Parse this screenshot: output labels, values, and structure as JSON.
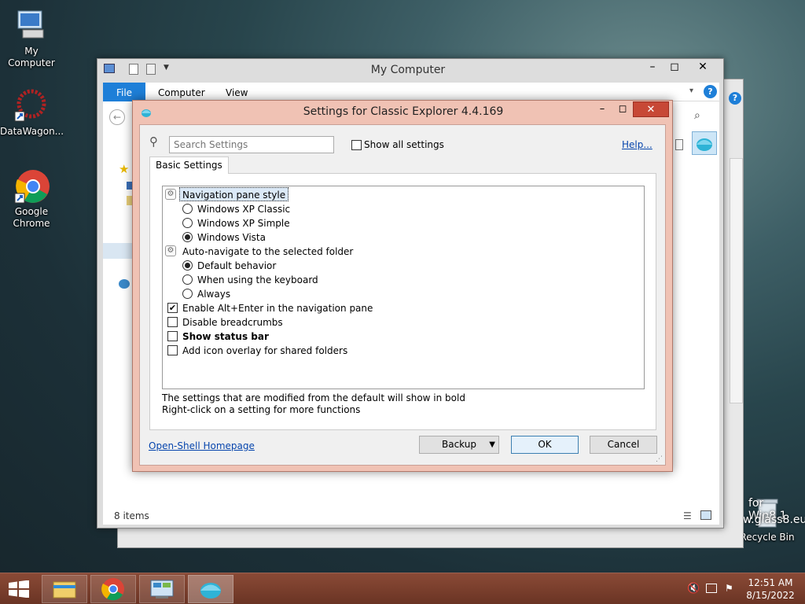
{
  "desktop": {
    "icons": [
      {
        "label": "My Computer"
      },
      {
        "label": "DataWagon..."
      },
      {
        "label": "Google Chrome"
      },
      {
        "label": "Recycle Bin"
      }
    ],
    "watermark_line1": "for Win8.1",
    "watermark_line2": "w.glass8.eu"
  },
  "explorer": {
    "title": "My Computer",
    "tabs": [
      "File",
      "Computer",
      "View"
    ],
    "status_items": "8 items"
  },
  "dialog": {
    "title": "Settings for Classic Explorer 4.4.169",
    "search_placeholder": "Search Settings",
    "show_all_label": "Show all settings",
    "help_link": "Help...",
    "tab_basic": "Basic Settings",
    "settings": [
      {
        "type": "group",
        "label": "Navigation pane style"
      },
      {
        "type": "radio",
        "label": "Windows XP Classic",
        "checked": false
      },
      {
        "type": "radio",
        "label": "Windows XP Simple",
        "checked": false
      },
      {
        "type": "radio",
        "label": "Windows Vista",
        "checked": true
      },
      {
        "type": "group",
        "label": "Auto-navigate to the selected folder"
      },
      {
        "type": "radio",
        "label": "Default behavior",
        "checked": true
      },
      {
        "type": "radio",
        "label": "When using the keyboard",
        "checked": false
      },
      {
        "type": "radio",
        "label": "Always",
        "checked": false
      },
      {
        "type": "check",
        "label": "Enable Alt+Enter in the navigation pane",
        "checked": true
      },
      {
        "type": "check",
        "label": "Disable breadcrumbs",
        "checked": false
      },
      {
        "type": "check",
        "label": "Show status bar",
        "checked": false,
        "bold": true
      },
      {
        "type": "check",
        "label": "Add icon overlay for shared folders",
        "checked": false
      }
    ],
    "hint_line1": "The settings that are modified from the default will show in bold",
    "hint_line2": "Right-click on a setting for more functions",
    "homepage_link": "Open-Shell Homepage",
    "backup_label": "Backup",
    "ok_label": "OK",
    "cancel_label": "Cancel"
  },
  "taskbar": {
    "time": "12:51 AM",
    "date": "8/15/2022"
  },
  "colors": {
    "dialog_frame": "#f0c2b4",
    "taskbar": "#7a3e2c",
    "accent_blue": "#1e7fd8"
  }
}
